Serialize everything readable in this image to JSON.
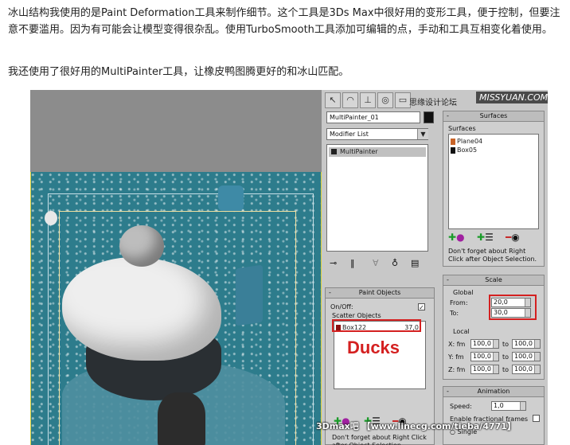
{
  "article": {
    "paragraph1": "冰山结构我使用的是Paint Deformation工具来制作细节。这个工具是3Ds Max中很好用的变形工具，便于控制，但要注意不要滥用。因为有可能会让模型变得很杂乱。使用TurboSmooth工具添加可编辑的点，手动和工具互相变化着使用。",
    "paragraph2": "我还使用了很好用的MultiPainter工具，让橡皮鸭图腾更好的和冰山匹配。"
  },
  "screenshot": {
    "watermark_top": "思缘设计论坛",
    "watermark_logo": "MISSYUAN.COM",
    "watermark_bottom": "3Dmax吧 【www.linecg.com/tieba/4771】",
    "annotation": "Ducks",
    "modifier_panel": {
      "object_name": "MultiPainter_01",
      "modifier_list": "Modifier List",
      "stack_item": "MultiPainter"
    },
    "paint_objects": {
      "title": "Paint Objects",
      "on_off_label": "On/Off:",
      "on_off_checked": true,
      "scatter_label": "Scatter Objects",
      "scatter_item_name": "Box122",
      "scatter_item_value": "37,0",
      "hint": "Don't forget about Right Click after Object Selection."
    },
    "surfaces": {
      "title": "Surfaces",
      "group_label": "Surfaces",
      "items": [
        {
          "name": "Plane04",
          "color": "#c86428"
        },
        {
          "name": "Box05",
          "color": "#111111"
        }
      ],
      "hint": "Don't forget about Right Click after Object Selection."
    },
    "scale": {
      "title": "Scale",
      "global_label": "Global",
      "from_label": "From:",
      "from_value": "20,0",
      "to_label": "To:",
      "to_value": "30,0",
      "local_label": "Local",
      "rows": [
        {
          "axis": "X: fm",
          "from": "100,0",
          "to_label": "to",
          "to": "100,0"
        },
        {
          "axis": "Y: fm",
          "from": "100,0",
          "to_label": "to",
          "to": "100,0"
        },
        {
          "axis": "Z: fm",
          "from": "100,0",
          "to_label": "to",
          "to": "100,0"
        }
      ]
    },
    "animation": {
      "title": "Animation",
      "speed_label": "Speed:",
      "speed_value": "1,0",
      "fractional_label": "Enable fractional frames",
      "single_label": "Single"
    },
    "colors": {
      "accent_red": "#d42020",
      "ground": "#2d7c8c"
    }
  }
}
